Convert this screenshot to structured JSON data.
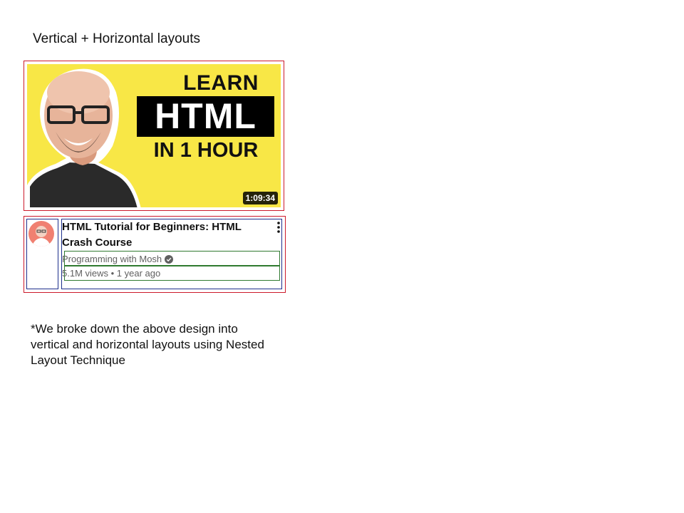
{
  "page": {
    "heading": "Vertical + Horizontal layouts",
    "note": "*We broke down the above design into vertical and horizontal layouts using Nested Layout Technique"
  },
  "video": {
    "thumbnail": {
      "line1": "LEARN",
      "line2": "HTML",
      "line3": "IN 1 HOUR",
      "background": "#f8e746",
      "duration": "1:09:34"
    },
    "title": "HTML Tutorial for Beginners: HTML Crash Course",
    "channel": "Programming with Mosh",
    "verified_icon": "check-circle-icon",
    "meta": "5.1M views • 1 year ago",
    "menu_icon": "more-vertical-icon"
  },
  "colors": {
    "outer_box": "#cc1a2b",
    "column_box": "#1d2f8c",
    "row_box": "#2f7a2f"
  }
}
